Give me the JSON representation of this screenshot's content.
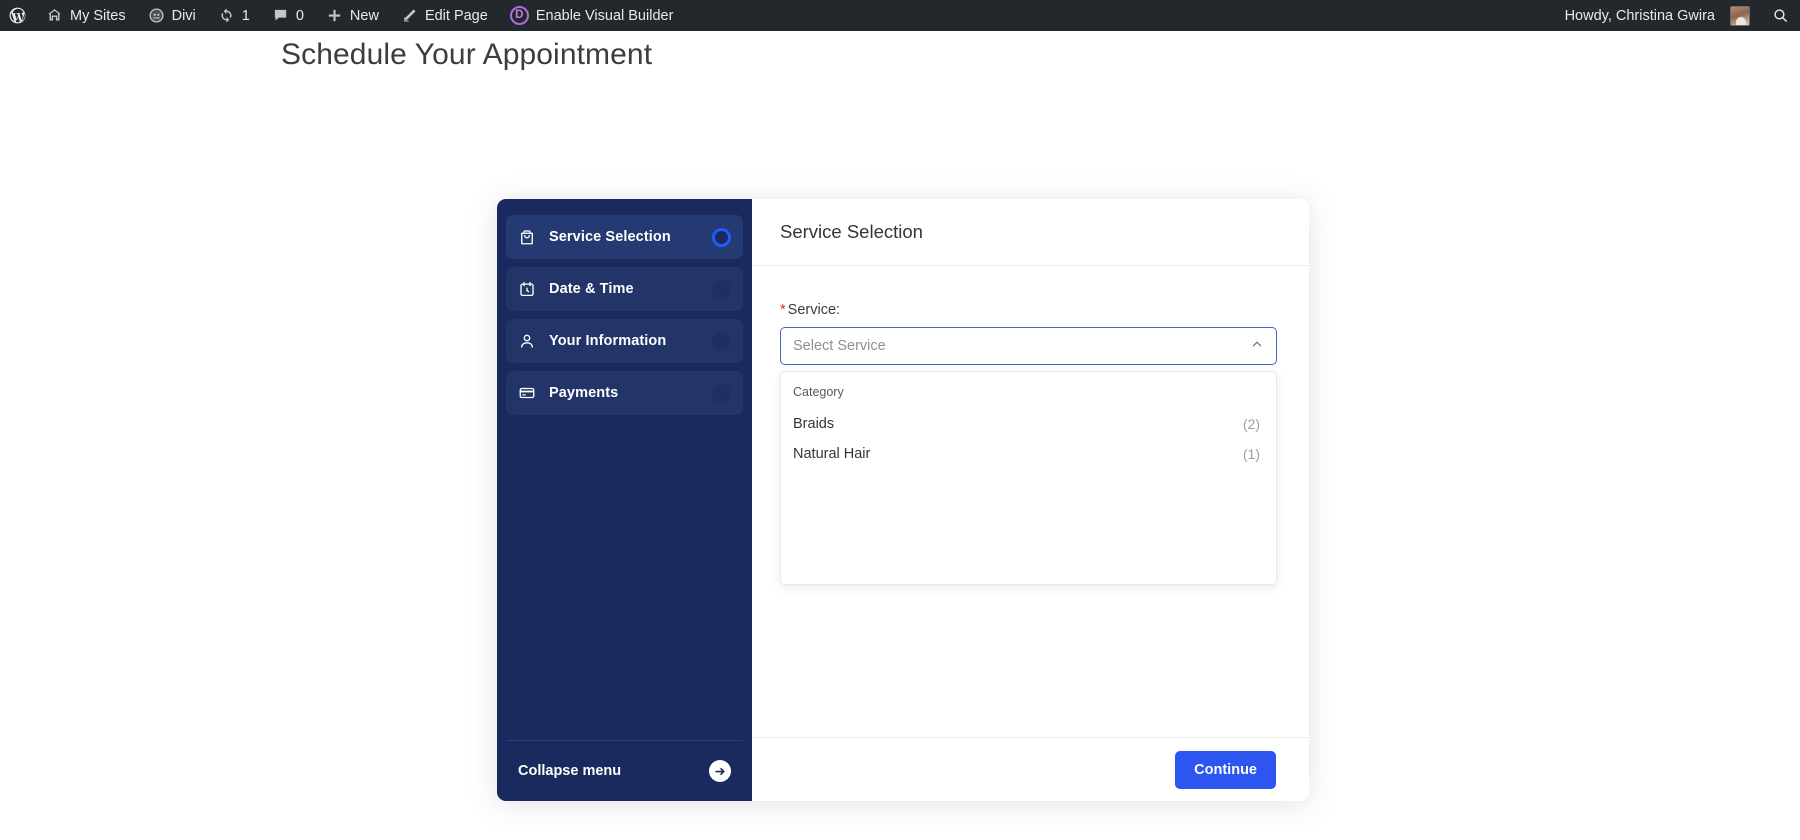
{
  "adminbar": {
    "left_items": [
      {
        "icon": "wordpress-logo-icon",
        "label": ""
      },
      {
        "icon": "sites-icon",
        "label": "My Sites"
      },
      {
        "icon": "divi-gauge-icon",
        "label": "Divi"
      },
      {
        "icon": "update-icon",
        "label": "1"
      },
      {
        "icon": "comment-icon",
        "label": "0"
      },
      {
        "icon": "plus-icon",
        "label": "New"
      },
      {
        "icon": "pencil-icon",
        "label": "Edit Page"
      },
      {
        "icon": "divi-badge-icon",
        "label": "Enable Visual Builder"
      }
    ],
    "howdy": "Howdy, Christina Gwira",
    "search_icon": "search-icon",
    "avatar_icon": "avatar"
  },
  "page": {
    "title": "Schedule Your Appointment"
  },
  "sidebar": {
    "steps": [
      {
        "label": "Service Selection",
        "icon": "shopping-bag-icon",
        "state": "current"
      },
      {
        "label": "Date & Time",
        "icon": "calendar-clock-icon",
        "state": "pending"
      },
      {
        "label": "Your Information",
        "icon": "person-icon",
        "state": "pending"
      },
      {
        "label": "Payments",
        "icon": "credit-card-icon",
        "state": "pending"
      }
    ],
    "collapse_label": "Collapse menu",
    "collapse_icon": "arrow-right-circle-icon"
  },
  "panel": {
    "heading": "Service Selection",
    "field": {
      "required_mark": "*",
      "label": "Service:",
      "placeholder": "Select Service",
      "value": "",
      "chevron_icon": "chevron-up-icon"
    },
    "dropdown": {
      "group_header": "Category",
      "options": [
        {
          "name": "Braids",
          "count": "(2)"
        },
        {
          "name": "Natural Hair",
          "count": "(1)"
        }
      ]
    },
    "footer": {
      "continue_label": "Continue"
    }
  },
  "colors": {
    "adminbar_bg": "#23282d",
    "sidebar_bg": "#1b2a5e",
    "step_bg": "#223468",
    "accent_blue": "#2d55ef",
    "active_ring": "#1d5ff5",
    "required_red": "#d93025"
  }
}
